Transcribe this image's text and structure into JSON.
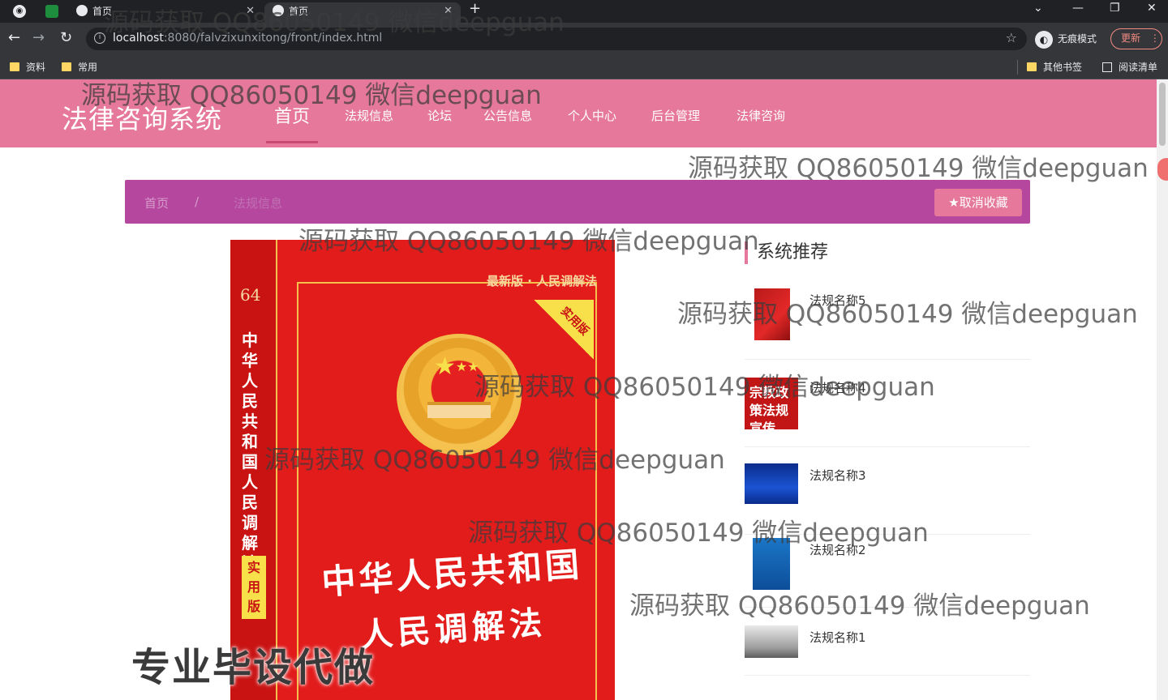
{
  "browser": {
    "tabs": [
      {
        "label": "首页"
      },
      {
        "label": "首页"
      }
    ],
    "new_tab_label": "+",
    "url_host": "localhost",
    "url_path": ":8080/falvzixunxitong/front/index.html",
    "incognito_label": "无痕模式",
    "update_label": "更新",
    "bookmarks": [
      {
        "label": "资料"
      },
      {
        "label": "常用"
      },
      {
        "label": "其他书签"
      },
      {
        "label": "阅读清单"
      }
    ]
  },
  "site": {
    "logo": "法律咨询系统",
    "nav": [
      {
        "label": "首页"
      },
      {
        "label": "法规信息"
      },
      {
        "label": "论坛"
      },
      {
        "label": "公告信息"
      },
      {
        "label": "个人中心"
      },
      {
        "label": "后台管理"
      },
      {
        "label": "法律咨询"
      }
    ]
  },
  "breadcrumb": {
    "home": "首页",
    "separator": "/",
    "current": "法规信息"
  },
  "favorite_button": "取消收藏",
  "book": {
    "number": "64",
    "spine_title": "中华人民共和国人民调解法",
    "spine_tag": "实用版",
    "edition": "最新版 · 人民调解法",
    "ribbon": "实用版",
    "title_line1": "中华人民共和国",
    "title_line2": "人民调解法"
  },
  "recommend": {
    "heading": "系统推荐",
    "items": [
      {
        "name": "法规名称5"
      },
      {
        "name": "法规名称4",
        "thumb_text": "宗教政策法规宣传"
      },
      {
        "name": "法规名称3"
      },
      {
        "name": "法规名称2"
      },
      {
        "name": "法规名称1"
      }
    ]
  },
  "overlay": {
    "watermark": "源码获取 QQ86050149 微信deepguan",
    "promo": "专业毕设代做"
  },
  "colors": {
    "header_pink": "#e5789b",
    "crumb_purple": "#b6479f",
    "book_red": "#e21b1b"
  }
}
